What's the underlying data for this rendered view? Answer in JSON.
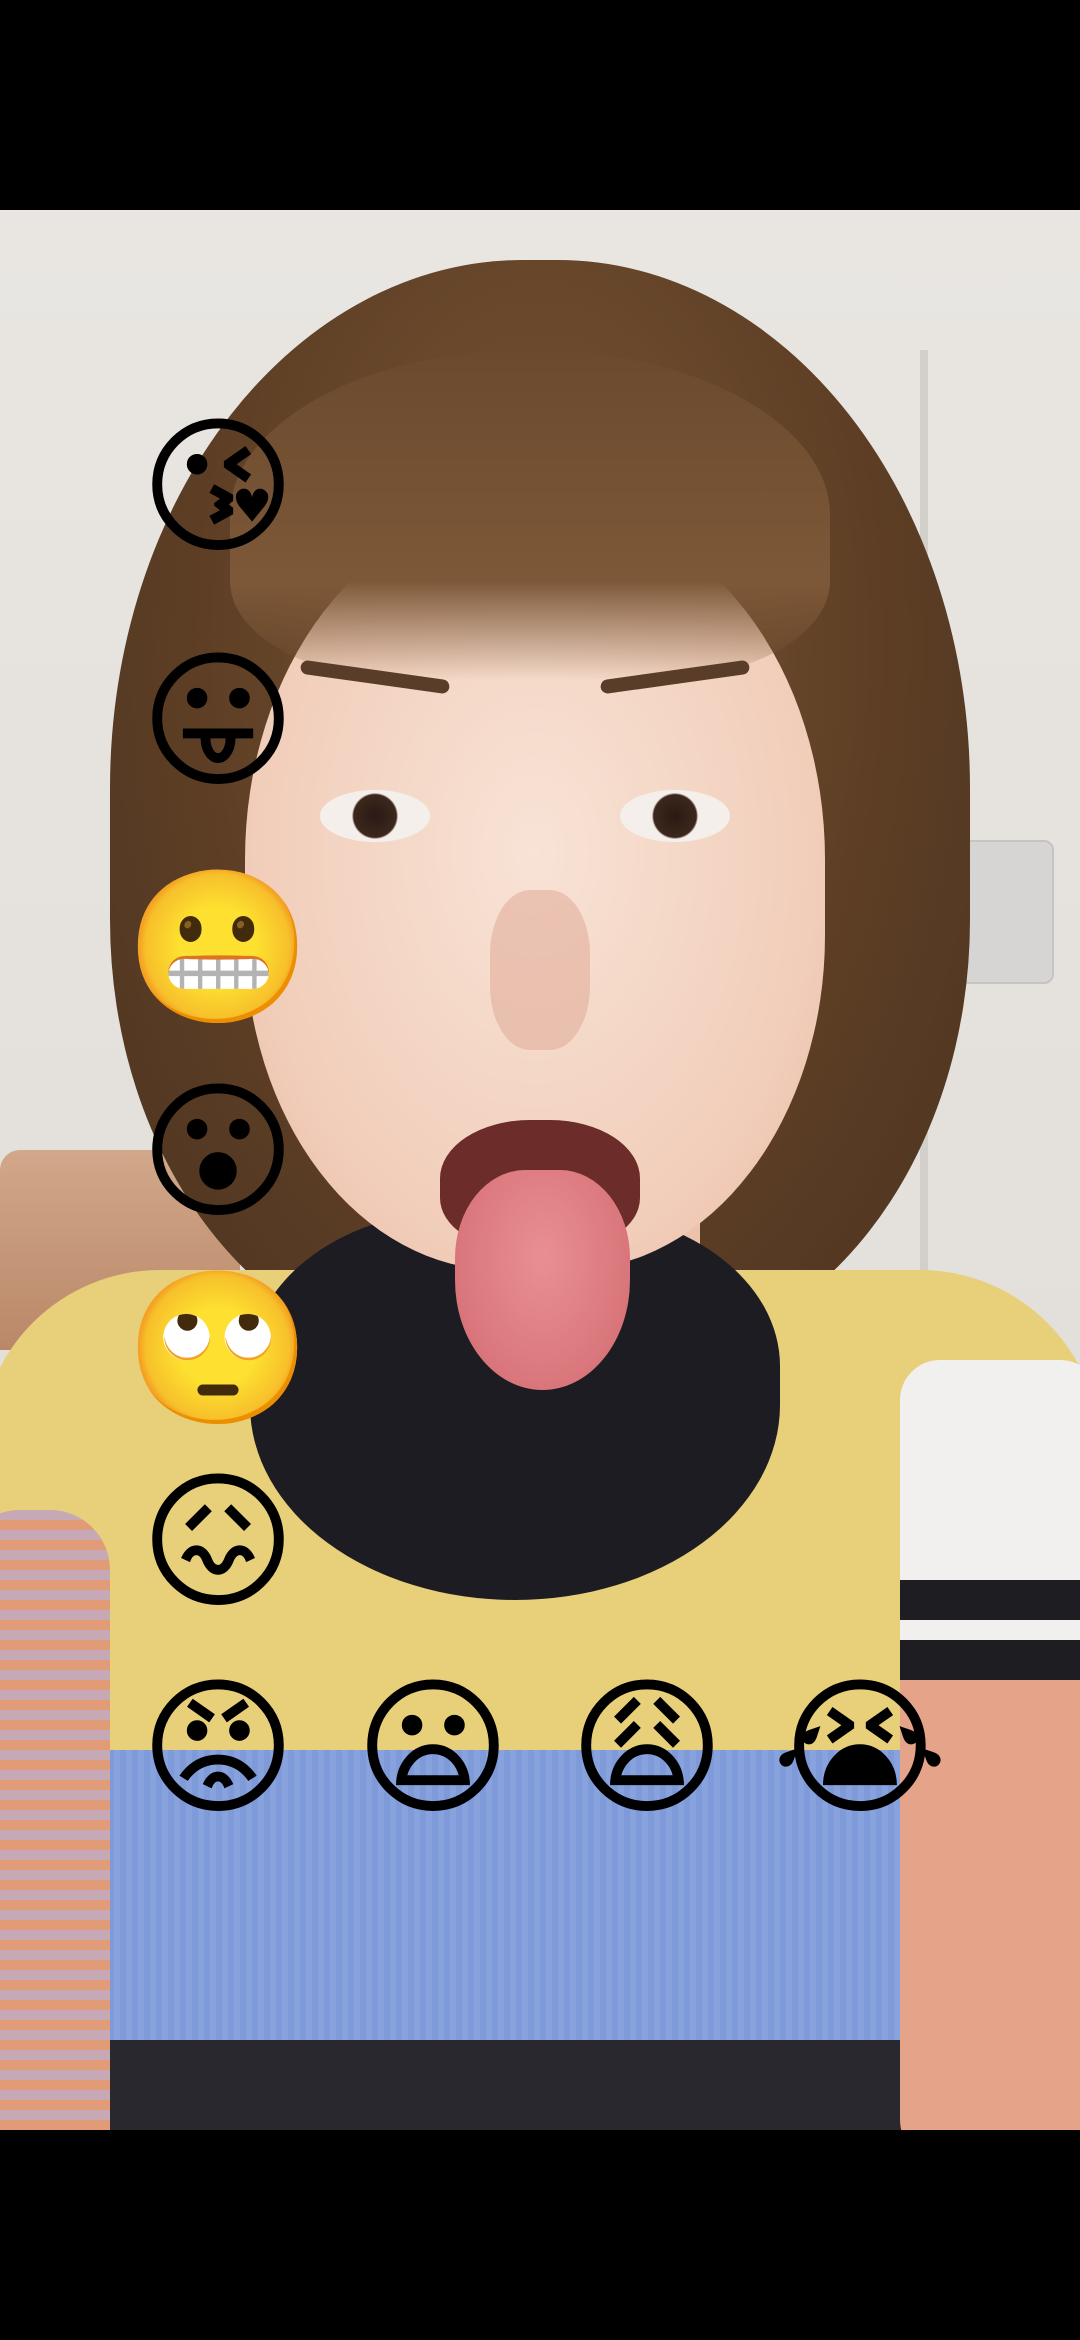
{
  "emojis": {
    "kissing_heart": "😘",
    "tongue_out": "😛",
    "grimacing": "😬",
    "surprised": "😮",
    "eye_roll": "🙄",
    "confounded": "😖",
    "angry": "😡",
    "anxious": "😦",
    "weary": "😩",
    "crying": "😭"
  },
  "colors": {
    "emoji_yellow": "#F9B92E",
    "emoji_orange_red": "#F15A24",
    "background_black": "#000000"
  }
}
